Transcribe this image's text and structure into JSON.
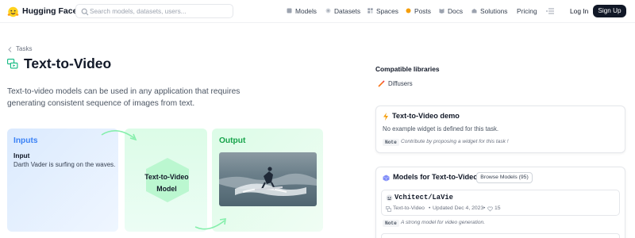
{
  "nav": {
    "brand": "Hugging Face",
    "search_placeholder": "Search models, datasets, users...",
    "items": [
      {
        "label": "Models",
        "icon": "cube-icon"
      },
      {
        "label": "Datasets",
        "icon": "database-icon"
      },
      {
        "label": "Spaces",
        "icon": "grid-icon"
      },
      {
        "label": "Posts",
        "icon": "dot-icon"
      },
      {
        "label": "Docs",
        "icon": "book-icon"
      },
      {
        "label": "Solutions",
        "icon": "building-icon"
      },
      {
        "label": "Pricing",
        "icon": ""
      }
    ],
    "login": "Log In",
    "signup": "Sign Up"
  },
  "breadcrumb": {
    "label": "Tasks"
  },
  "page": {
    "title": "Text-to-Video",
    "description": "Text-to-video models can be used in any application that requires generating consistent sequence of images from text."
  },
  "diagram": {
    "inputs_title": "Inputs",
    "input_label": "Input",
    "input_text": "Darth Vader is surfing on the waves.",
    "model_line1": "Text-to-Video",
    "model_line2": "Model",
    "output_title": "Output"
  },
  "sidebar": {
    "compat_title": "Compatible libraries",
    "library": "Diffusers",
    "demo": {
      "title": "Text-to-Video demo",
      "text": "No example widget is defined for this task.",
      "note_badge": "Note",
      "note_text": "Contribute by proposing a widget for this task !"
    },
    "models": {
      "title": "Models for Text-to-Video",
      "browse": "Browse Models (95)",
      "entry": {
        "name": "Vchitect/LaVie",
        "task": "Text-to-Video",
        "updated": "Updated Dec 4, 2023",
        "likes": "15"
      },
      "note_badge": "Note",
      "note_text": "A strong model for video generation."
    }
  },
  "colors": {
    "accent_blue": "#3b82f6",
    "accent_green": "#16a34a",
    "brand_yellow": "#FFD21E",
    "dark_button": "#111827"
  }
}
